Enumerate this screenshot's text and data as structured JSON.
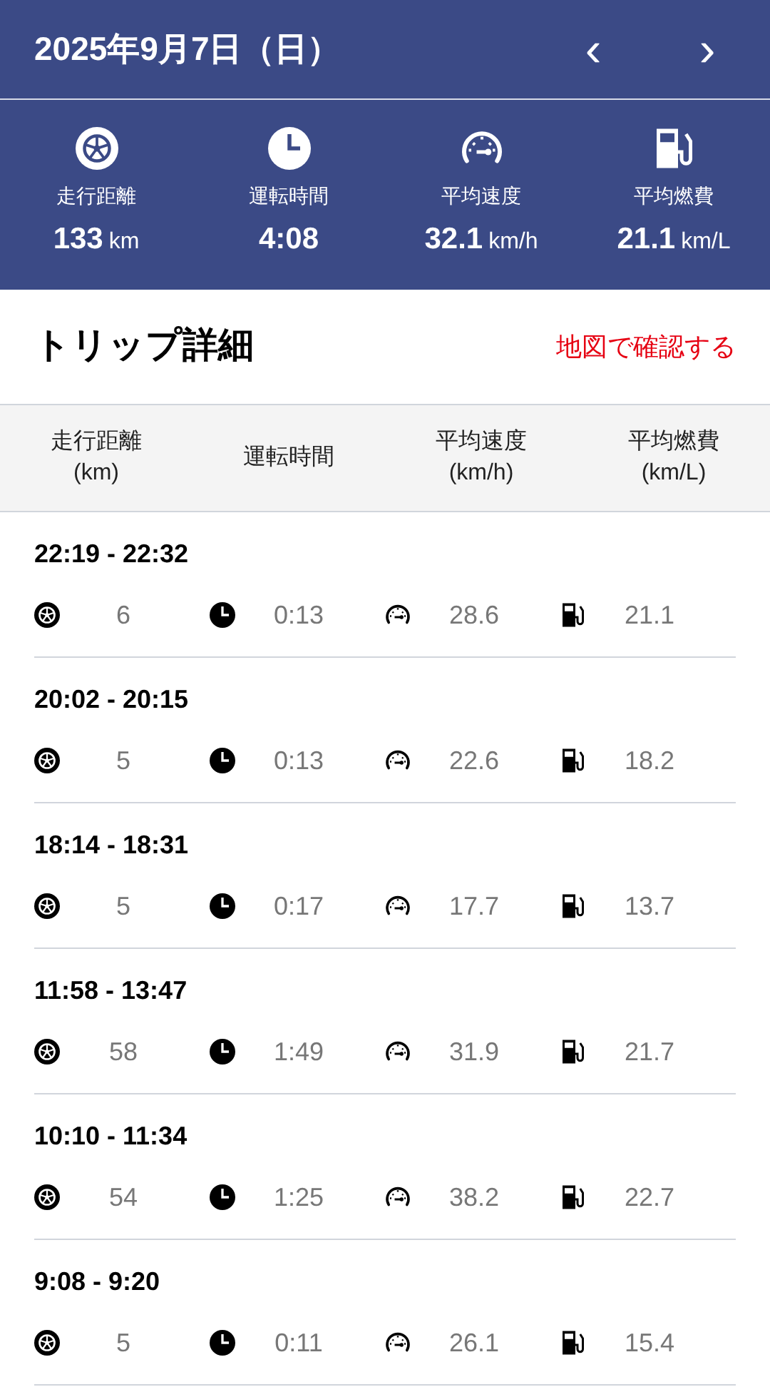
{
  "header": {
    "date": "2025年9月7日（日）",
    "prev": "‹",
    "next": "›"
  },
  "summary": [
    {
      "kind": "distance",
      "label": "走行距離",
      "value": "133",
      "unit": "km"
    },
    {
      "kind": "time",
      "label": "運転時間",
      "value": "4:08"
    },
    {
      "kind": "speed",
      "label": "平均速度",
      "value": "32.1",
      "unit": "km/h"
    },
    {
      "kind": "fuel",
      "label": "平均燃費",
      "value": "21.1",
      "unit": "km/L"
    }
  ],
  "trip_details": {
    "title": "トリップ詳細",
    "map_link": "地図で確認する",
    "columns": [
      [
        "走行距離",
        "(km)"
      ],
      [
        "運転時間"
      ],
      [
        "平均速度",
        "(km/h)"
      ],
      [
        "平均燃費",
        "(km/L)"
      ]
    ],
    "trips": [
      {
        "time": "22:19 - 22:32",
        "distance": "6",
        "duration": "0:13",
        "speed": "28.6",
        "fuel": "21.1"
      },
      {
        "time": "20:02 - 20:15",
        "distance": "5",
        "duration": "0:13",
        "speed": "22.6",
        "fuel": "18.2"
      },
      {
        "time": "18:14 - 18:31",
        "distance": "5",
        "duration": "0:17",
        "speed": "17.7",
        "fuel": "13.7"
      },
      {
        "time": "11:58 - 13:47",
        "distance": "58",
        "duration": "1:49",
        "speed": "31.9",
        "fuel": "21.7"
      },
      {
        "time": "10:10 - 11:34",
        "distance": "54",
        "duration": "1:25",
        "speed": "38.2",
        "fuel": "22.7"
      },
      {
        "time": "9:08 - 9:20",
        "distance": "5",
        "duration": "0:11",
        "speed": "26.1",
        "fuel": "15.4"
      }
    ]
  }
}
